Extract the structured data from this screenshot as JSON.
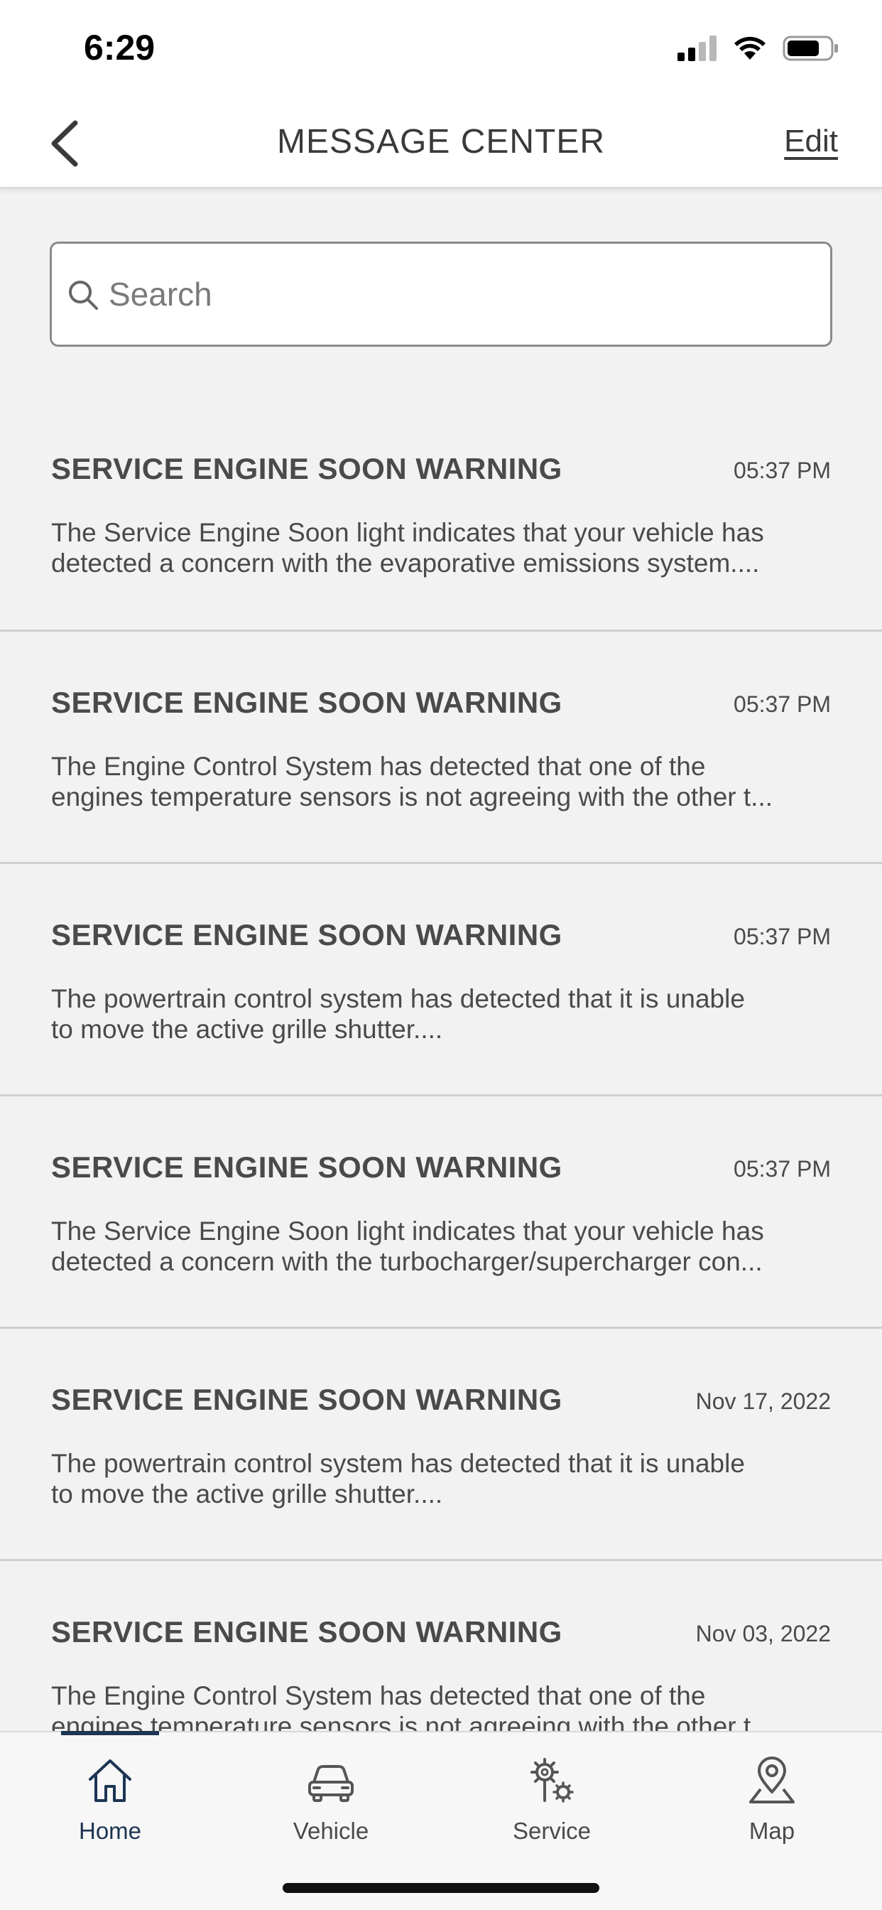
{
  "status_bar": {
    "time": "6:29"
  },
  "nav": {
    "title": "MESSAGE CENTER",
    "edit_label": "Edit"
  },
  "search": {
    "placeholder": "Search",
    "value": ""
  },
  "messages": [
    {
      "title": "SERVICE ENGINE SOON WARNING",
      "time": "05:37 PM",
      "line1": "The Service Engine Soon light indicates that your vehicle has",
      "line2": "detected a concern with the evaporative emissions system...."
    },
    {
      "title": "SERVICE ENGINE SOON WARNING",
      "time": "05:37 PM",
      "line1": "The Engine Control System has detected that one of the",
      "line2": "engines temperature sensors is not agreeing with the other t..."
    },
    {
      "title": "SERVICE ENGINE SOON WARNING",
      "time": "05:37 PM",
      "line1": "The powertrain control system has detected that it is unable",
      "line2": "to move the active grille shutter...."
    },
    {
      "title": "SERVICE ENGINE SOON WARNING",
      "time": "05:37 PM",
      "line1": "The Service Engine Soon light indicates that your vehicle has",
      "line2": "detected a concern with the turbocharger/supercharger con..."
    },
    {
      "title": "SERVICE ENGINE SOON WARNING",
      "time": "Nov 17, 2022",
      "line1": "The powertrain control system has detected that it is unable",
      "line2": "to move the active grille shutter...."
    },
    {
      "title": "SERVICE ENGINE SOON WARNING",
      "time": "Nov 03, 2022",
      "line1": "The Engine Control System has detected that one of the",
      "line2": "engines temperature sensors is not agreeing with the other t..."
    }
  ],
  "tabs": [
    {
      "label": "Home",
      "icon": "home-icon",
      "active": true
    },
    {
      "label": "Vehicle",
      "icon": "car-icon",
      "active": false
    },
    {
      "label": "Service",
      "icon": "service-gears-icon",
      "active": false
    },
    {
      "label": "Map",
      "icon": "map-pin-icon",
      "active": false
    }
  ],
  "colors": {
    "accent": "#1c3553",
    "background": "#f2f2f2",
    "text": "#4a4a4a"
  }
}
